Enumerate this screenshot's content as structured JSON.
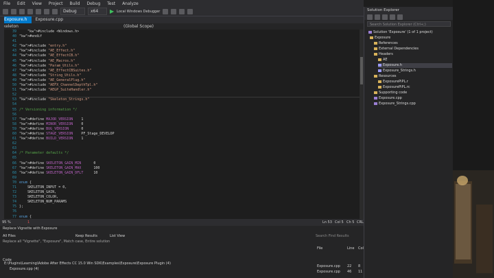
{
  "menu": [
    "File",
    "Edit",
    "View",
    "Project",
    "Build",
    "Debug",
    "Test",
    "Analyze"
  ],
  "toolbar": {
    "config": "Debug",
    "platform": "x64",
    "debugger": "Local Windows Debugger"
  },
  "tabs": [
    "Exposure.h",
    "Exposure.cpp"
  ],
  "left_tab": "Skeleton",
  "navbar": {
    "scope": "(Global Scope)"
  },
  "editor": {
    "lines": [
      {
        "n": "39",
        "t": "    #include <Windows.h>"
      },
      {
        "n": "40",
        "t": "#endif"
      },
      {
        "n": "41",
        "t": ""
      },
      {
        "n": "42",
        "t": "#include \"entry.h\""
      },
      {
        "n": "43",
        "t": "#include \"AE_Effect.h\""
      },
      {
        "n": "44",
        "t": "#include \"AE_EffectCB.h\""
      },
      {
        "n": "45",
        "t": "#include \"AE_Macros.h\""
      },
      {
        "n": "46",
        "t": "#include \"Param_Utils.h\""
      },
      {
        "n": "47",
        "t": "#include \"AE_EffectCBSuites.h\""
      },
      {
        "n": "48",
        "t": "#include \"String_Utils.h\""
      },
      {
        "n": "49",
        "t": "#include \"AE_GeneralPlug.h\""
      },
      {
        "n": "50",
        "t": "#include \"AEFX_ChannelDepthTpl.h\""
      },
      {
        "n": "51",
        "t": "#include \"AEGP_SuiteHandler.h\""
      },
      {
        "n": "52",
        "t": ""
      },
      {
        "n": "53",
        "t": "#include \"Skeleton_Strings.h\""
      },
      {
        "n": "54",
        "t": ""
      },
      {
        "n": "55",
        "t": "/* Versioning information */"
      },
      {
        "n": "56",
        "t": ""
      },
      {
        "n": "57",
        "t": "#define MAJOR_VERSION    1"
      },
      {
        "n": "58",
        "t": "#define MINOR_VERSION    0"
      },
      {
        "n": "59",
        "t": "#define BUG_VERSION      0"
      },
      {
        "n": "60",
        "t": "#define STAGE_VERSION    PF_Stage_DEVELOP"
      },
      {
        "n": "61",
        "t": "#define BUILD_VERSION    1"
      },
      {
        "n": "62",
        "t": ""
      },
      {
        "n": "63",
        "t": ""
      },
      {
        "n": "64",
        "t": "/* Parameter defaults */"
      },
      {
        "n": "65",
        "t": ""
      },
      {
        "n": "66",
        "t": "#define SKELETON_GAIN_MIN      0"
      },
      {
        "n": "67",
        "t": "#define SKELETON_GAIN_MAX      100"
      },
      {
        "n": "68",
        "t": "#define SKELETON_GAIN_DFLT     10"
      },
      {
        "n": "69",
        "t": ""
      },
      {
        "n": "70",
        "t": "enum {"
      },
      {
        "n": "71",
        "t": "    SKELETON_INPUT = 0,"
      },
      {
        "n": "72",
        "t": "    SKELETON_GAIN,"
      },
      {
        "n": "73",
        "t": "    SKELETON_COLOR,"
      },
      {
        "n": "74",
        "t": "    SKELETON_NUM_PARAMS"
      },
      {
        "n": "75",
        "t": "};"
      },
      {
        "n": "76",
        "t": ""
      },
      {
        "n": "77",
        "t": "enum {"
      },
      {
        "n": "78",
        "t": "    GAIN_DISK_ID = 1,"
      }
    ]
  },
  "edstatus": {
    "zoom": "95 %",
    "issues": "1",
    "ln": "Ln 53",
    "col": "Col 5",
    "ch": "Ch 5",
    "mode": "TABS",
    "ovr": "CRLF"
  },
  "find": {
    "title": "Replace Vignette with Exposure",
    "scope": "All Files",
    "keep": "Keep Results",
    "listview": "List View",
    "desc": "Replace all \"Vignette\", \"Exposure\", Match case, Entire solution",
    "search_ph": "Search Find Results",
    "col_code": "Code",
    "col_file": "File",
    "col_line": "Line",
    "col_col": "Col",
    "path": "E:\\Plugins\\Learning\\Adobe After Effects CC 15.0 Win SDK\\Examples\\Exposure\\Exposure Plugin (4)",
    "rows": [
      {
        "code": "Exposure.cpp (4)",
        "file": "Exposure.cpp",
        "line": "22",
        "col": "8"
      },
      {
        "code": "",
        "file": "Exposure.cpp",
        "line": "46",
        "col": "11"
      }
    ]
  },
  "solution": {
    "header": "Solution Explorer",
    "search": "Search Solution Explorer (Ctrl+;)",
    "solution_label": "Solution 'Exposure' (1 of 1 project)",
    "items": [
      {
        "label": "Exposure",
        "indent": 1
      },
      {
        "label": "References",
        "indent": 2
      },
      {
        "label": "External Dependencies",
        "indent": 2
      },
      {
        "label": "Headers",
        "indent": 2
      },
      {
        "label": "AE",
        "indent": 3
      },
      {
        "label": "Exposure.h",
        "indent": 3,
        "selected": true
      },
      {
        "label": "Exposure_Strings.h",
        "indent": 3
      },
      {
        "label": "Resources",
        "indent": 2
      },
      {
        "label": "ExposurePiPL.r",
        "indent": 3
      },
      {
        "label": "ExposurePiPL.rc",
        "indent": 3
      },
      {
        "label": "Supporting code",
        "indent": 2
      },
      {
        "label": "Exposure.cpp",
        "indent": 2
      },
      {
        "label": "Exposure_Strings.cpp",
        "indent": 2
      }
    ]
  },
  "colors": {
    "accent": "#007acc",
    "bg": "#1e1e1e",
    "panel": "#252526",
    "macro": "#bd63c5",
    "string": "#d69d85",
    "comment": "#57a64a",
    "linenum": "#2b91af"
  }
}
